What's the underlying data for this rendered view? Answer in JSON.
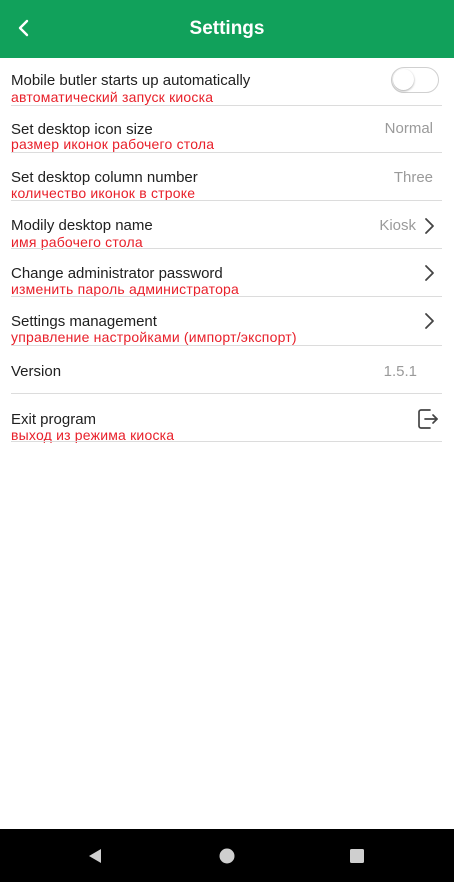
{
  "appbar": {
    "title": "Settings",
    "back_icon": "chevron-left-icon",
    "color": "#11a15b"
  },
  "settings": {
    "autostart": {
      "label": "Mobile butler starts up automatically",
      "note": "автоматический запуск киоска",
      "toggle_on": false
    },
    "icon_size": {
      "label": "Set desktop icon size",
      "note": "размер иконок рабочего стола",
      "value": "Normal"
    },
    "column_number": {
      "label": "Set desktop column number",
      "note": "количество иконок в строке",
      "value": "Three"
    },
    "desktop_name": {
      "label": "Modily desktop name",
      "note": "имя рабочего стола",
      "value": "Kiosk"
    },
    "admin_password": {
      "label": "Change administrator password",
      "note": "изменить пароль администратора"
    },
    "settings_management": {
      "label": "Settings management",
      "note": "управление настройками (импорт/экспорт)"
    },
    "version": {
      "label": "Version",
      "value": "1.5.1"
    },
    "exit": {
      "label": "Exit program",
      "note": "выход из режима киоска",
      "icon": "exit-icon"
    }
  },
  "annotation_color": "#e8202a",
  "navbar": {
    "icons": [
      "back-triangle-icon",
      "home-circle-icon",
      "recents-square-icon"
    ]
  }
}
